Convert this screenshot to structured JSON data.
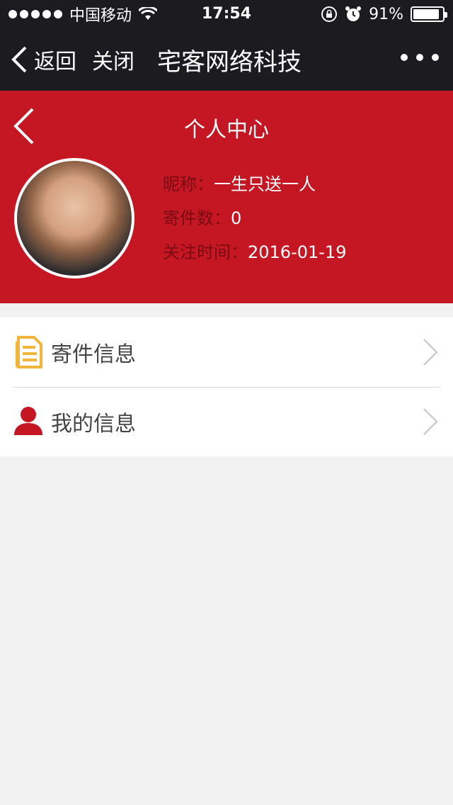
{
  "status_bar": {
    "carrier": "中国移动",
    "time": "17:54",
    "battery_percent": "91%",
    "battery_level": 0.91,
    "icons": [
      "signal-dots-icon",
      "wifi-icon",
      "rotation-lock-icon",
      "alarm-icon",
      "battery-icon"
    ]
  },
  "nav_bar": {
    "back_label": "返回",
    "close_label": "关闭",
    "title": "宅客网络科技",
    "more_icon": "more-icon"
  },
  "profile": {
    "page_title": "个人中心",
    "fields": [
      {
        "label": "昵称：",
        "value": "一生只送一人"
      },
      {
        "label": "寄件数：",
        "value": "0"
      },
      {
        "label": "关注时间：",
        "value": "2016-01-19"
      }
    ],
    "colors": {
      "header_bg": "#c41623",
      "label": "#7a0c12"
    }
  },
  "menu": {
    "items": [
      {
        "label": "寄件信息",
        "icon": "document-icon",
        "icon_color": "#f0b53a"
      },
      {
        "label": "我的信息",
        "icon": "user-icon",
        "icon_color": "#c41623"
      }
    ]
  }
}
